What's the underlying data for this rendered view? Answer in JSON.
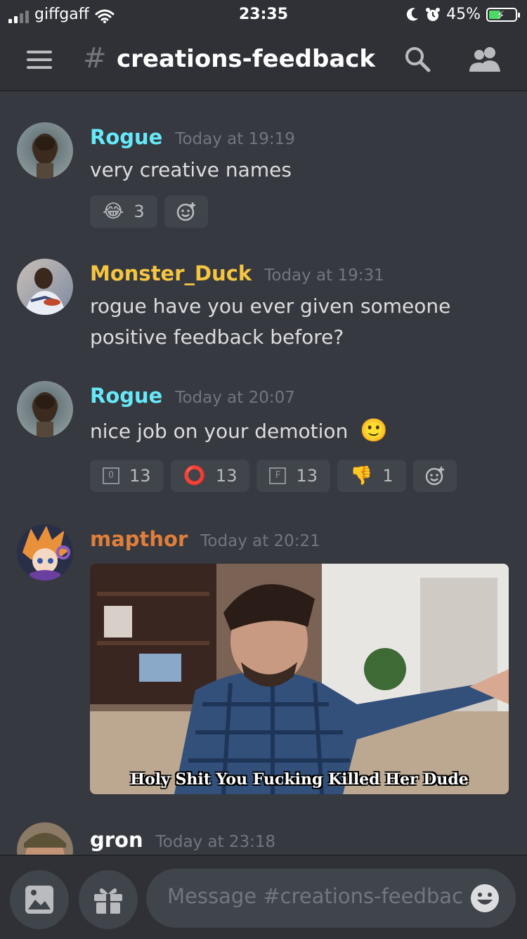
{
  "status_bar": {
    "carrier": "giffgaff",
    "time": "23:35",
    "battery_percent": "45%",
    "battery_level": 0.45,
    "icons": [
      "signal-icon",
      "wifi-icon",
      "moon-icon",
      "alarm-icon",
      "battery-charging-icon"
    ]
  },
  "header": {
    "hash": "#",
    "channel_name": "creations-feedback",
    "icons": [
      "menu-icon",
      "search-icon",
      "members-icon"
    ]
  },
  "messages": [
    {
      "author": "Rogue",
      "author_color": "#67e8f9",
      "timestamp": "Today at 19:19",
      "text": "very creative names",
      "reactions": [
        {
          "emoji": "😂",
          "emoji_name": "joy-emoji",
          "count": "3"
        }
      ]
    },
    {
      "author": "Monster_Duck",
      "author_color": "#f5c542",
      "timestamp": "Today at 19:31",
      "text": "rogue have you ever given someone positive feedback before?"
    },
    {
      "author": "Rogue",
      "author_color": "#67e8f9",
      "timestamp": "Today at 20:07",
      "text": "nice job on your demotion",
      "inline_emoji": "🙂",
      "reactions": [
        {
          "emoji": "O",
          "emoji_name": "letter-o-emoji",
          "count": "13"
        },
        {
          "emoji": "⭕",
          "emoji_name": "red-circle-emoji",
          "count": "13"
        },
        {
          "emoji": "F",
          "emoji_name": "letter-f-emoji",
          "count": "13"
        },
        {
          "emoji": "👎",
          "emoji_name": "thumbs-down-emoji",
          "count": "1"
        }
      ]
    },
    {
      "author": "mapthor",
      "author_color": "#e07f3c",
      "timestamp": "Today at 20:21",
      "gif_caption": "Holy Shit You Fucking Killed Her Dude"
    },
    {
      "author": "gron",
      "author_color": "#ffffff",
      "timestamp": "Today at 23:18"
    }
  ],
  "composer": {
    "placeholder": "Message #creations-feedback",
    "icons": [
      "image-icon",
      "gift-icon",
      "emoji-icon"
    ]
  },
  "colors": {
    "background": "#36393f",
    "header_bg": "#2f3136",
    "reaction_bg": "#40444b",
    "timestamp": "#72767d"
  }
}
